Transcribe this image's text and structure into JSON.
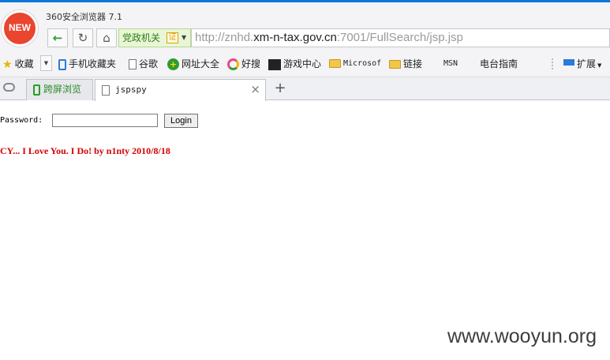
{
  "browser": {
    "logo_text": "NEW",
    "title": "360安全浏览器 7.1",
    "cert_label": "党政机关",
    "cert_mark": "证",
    "url_prefix": "http://znhd.",
    "url_host": "xm-n-tax.gov.cn",
    "url_suffix": ":7001/FullSearch/jsp.jsp",
    "accent_color": "#0a79d8"
  },
  "bookmarks": {
    "favorites": "收藏",
    "items": [
      {
        "label": "手机收藏夹",
        "icon": "phone-icon"
      },
      {
        "label": "谷歌",
        "icon": "page-icon"
      },
      {
        "label": "网址大全",
        "icon": "site-directory-icon"
      },
      {
        "label": "好搜",
        "icon": "haosou-icon"
      },
      {
        "label": "游戏中心",
        "icon": "game-icon"
      },
      {
        "label": "Microsof",
        "icon": "folder-icon"
      },
      {
        "label": "链接",
        "icon": "folder-icon"
      },
      {
        "label": "MSN",
        "icon": "msn-icon"
      },
      {
        "label": "电台指南",
        "icon": "radio-guide-icon"
      }
    ],
    "extensions": "扩展"
  },
  "tabs": [
    {
      "label": "跨屏浏览",
      "active": false
    },
    {
      "label": "jspspy",
      "active": true
    }
  ],
  "page": {
    "password_label": "Password:",
    "password_value": "",
    "login_button": "Login",
    "credit": "CY... I Love You. I Do! by n1nty 2010/8/18",
    "credit_color": "#d40000"
  },
  "watermark": "www.wooyun.org"
}
